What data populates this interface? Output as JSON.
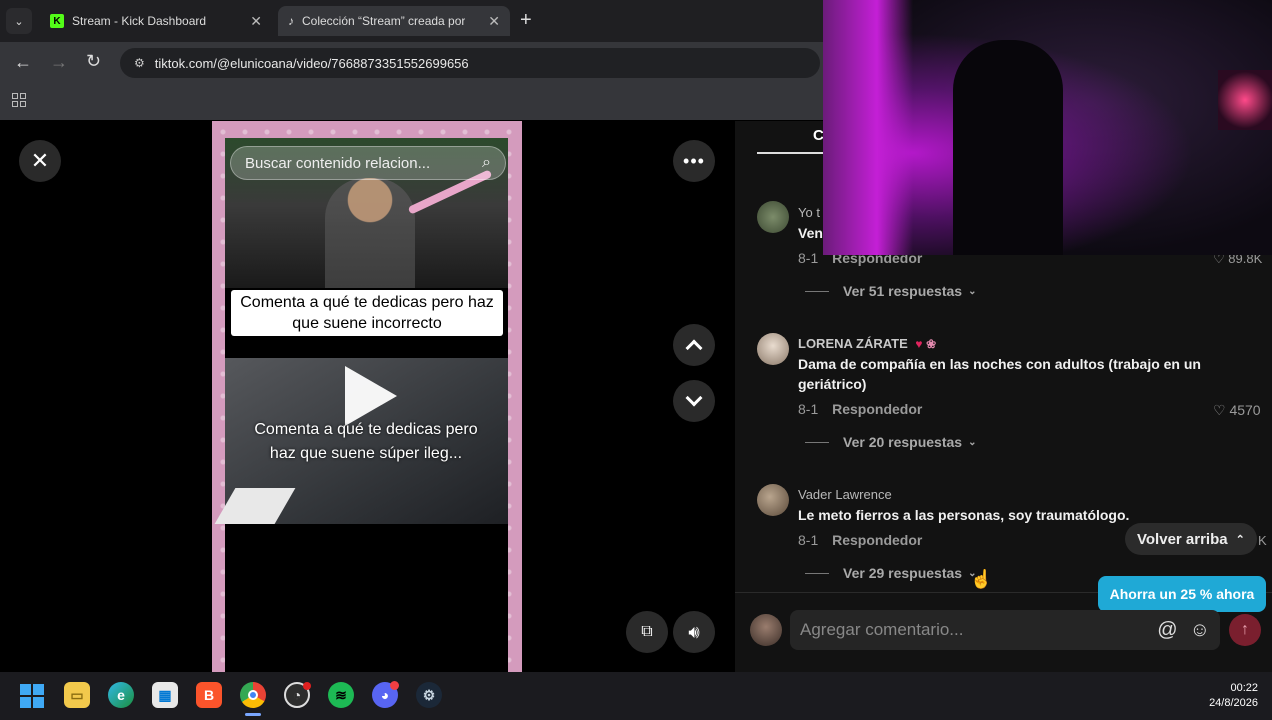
{
  "browser": {
    "tabs": [
      {
        "label": "Stream - Kick Dashboard",
        "active": false
      },
      {
        "label": "Colección “Stream” creada por",
        "active": true
      }
    ],
    "new_tab_label": "+",
    "url": "tiktok.com/@elunicoana/video/7668873351552699656"
  },
  "video": {
    "search_placeholder": "Buscar contenido relacion...",
    "caption_1": "Comenta a qué te dedicas pero haz que suene incorrecto",
    "caption_2": "Comenta a qué te dedicas pero haz que suene súper ileg..."
  },
  "comments": {
    "tab_label": "C",
    "items": [
      {
        "name": "Yo t",
        "text": "Ven",
        "date": "8-1",
        "reply_label": "Respondedor",
        "likes": "89.8K",
        "view_replies": "Ver 51 respuestas"
      },
      {
        "name": "LORENA ZÁRATE",
        "text": "Dama de compañía en las noches con adultos (trabajo en un geriátrico)",
        "date": "8-1",
        "reply_label": "Respondedor",
        "likes": "4570",
        "view_replies": "Ver 20 respuestas"
      },
      {
        "name": "Vader Lawrence",
        "text": "Le meto fierros a las personas, soy traumatólogo.",
        "date": "8-1",
        "reply_label": "Respondedor",
        "likes": "K",
        "view_replies": "Ver 29 respuestas"
      }
    ],
    "back_to_top": "Volver arriba",
    "promo": "Ahorra un 25 % ahora",
    "input_placeholder": "Agregar comentario..."
  },
  "taskbar": {
    "time": "00:22",
    "date": "24/8/2026"
  },
  "colors": {
    "accent_pink": "#fe2c55",
    "promo_teal": "#1fa9d6",
    "frame_pink": "#d49bbd"
  }
}
